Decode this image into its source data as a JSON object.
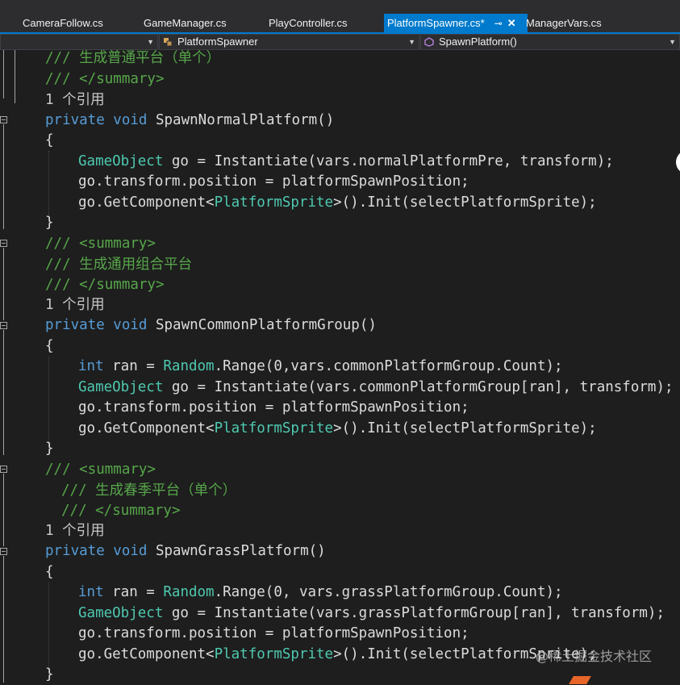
{
  "tabs": [
    {
      "label": "CameraFollow.cs",
      "active": false
    },
    {
      "label": "GameManager.cs",
      "active": false
    },
    {
      "label": "PlayController.cs",
      "active": false
    },
    {
      "label": "PlatformSpawner.cs*",
      "active": true
    },
    {
      "label": "ManagerVars.cs",
      "active": false
    }
  ],
  "tab_pin_icon": "pin-icon",
  "tab_close_icon": "close-icon",
  "nav": {
    "class_dropdown": "PlatformSpawner",
    "member_dropdown": "SpawnPlatform()"
  },
  "code": {
    "l1": "/// 生成普通平台（单个）",
    "l2": "/// </summary>",
    "l3": "1 个引用",
    "l4_k": "private void",
    "l4_n": " SpawnNormalPlatform()",
    "l5": "{",
    "l6_t": "GameObject",
    "l6_r": " go = Instantiate(vars.normalPlatformPre, transform);",
    "l7": "go.transform.position = platformSpawnPosition;",
    "l8_a": "go.GetComponent<",
    "l8_t": "PlatformSprite",
    "l8_b": ">().Init(selectPlatformSprite);",
    "l9": "}",
    "l10": "/// <summary>",
    "l11": "/// 生成通用组合平台",
    "l12": "/// </summary>",
    "l13": "1 个引用",
    "l14_k": "private void",
    "l14_n": " SpawnCommonPlatformGroup()",
    "l15": "{",
    "l16_k": "int",
    "l16_a": " ran = ",
    "l16_t": "Random",
    "l16_b": ".Range(0,vars.commonPlatformGroup.Count);",
    "l17_t": "GameObject",
    "l17_r": " go = Instantiate(vars.commonPlatformGroup[ran], transform);",
    "l18": "go.transform.position = platformSpawnPosition;",
    "l19_a": "go.GetComponent<",
    "l19_t": "PlatformSprite",
    "l19_b": ">().Init(selectPlatformSprite);",
    "l20": "}",
    "l21": "/// <summary>",
    "l22": "/// 生成春季平台（单个）",
    "l23": "/// </summary>",
    "l24": "1 个引用",
    "l25_k": "private void",
    "l25_n": " SpawnGrassPlatform()",
    "l26": "{",
    "l27_k": "int",
    "l27_a": " ran = ",
    "l27_t": "Random",
    "l27_b": ".Range(0, vars.grassPlatformGroup.Count);",
    "l28_t": "GameObject",
    "l28_r": " go = Instantiate(vars.grassPlatformGroup[ran], transform);",
    "l29": "go.transform.position = platformSpawnPosition;",
    "l30_a": "go.GetComponent<",
    "l30_t": "PlatformSprite",
    "l30_b": ">().Init(selectPlatformSprite);",
    "l31": "}"
  },
  "watermark": "@稀土掘金技术社区",
  "colors": {
    "background": "#1e1e1e",
    "comment": "#57a64a",
    "keyword": "#569cd6",
    "type": "#4ec9b0",
    "active_tab": "#007acc"
  }
}
